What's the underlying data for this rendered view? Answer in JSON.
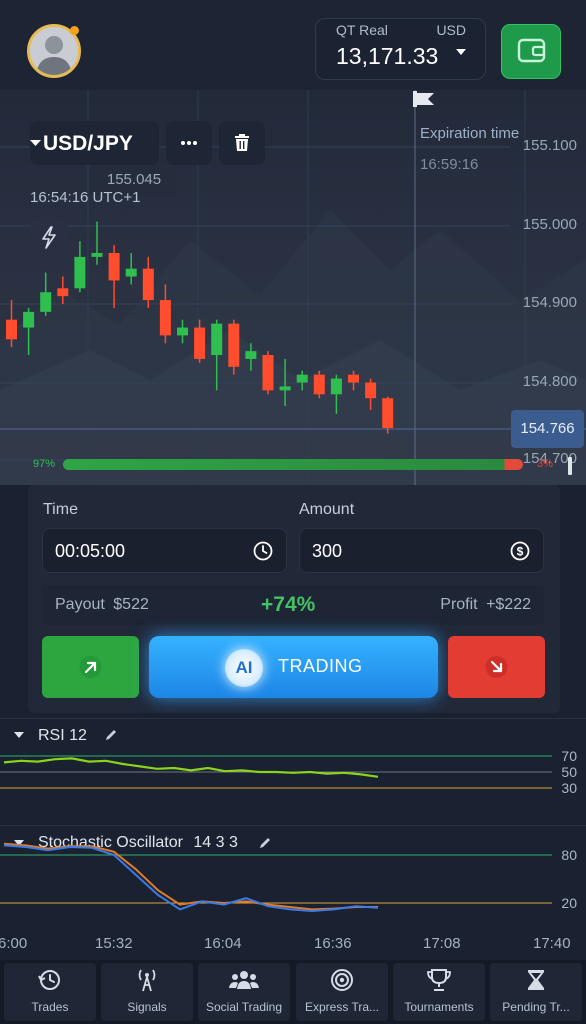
{
  "account": {
    "type_label": "QT Real",
    "currency": "USD",
    "balance": "13,171.33"
  },
  "asset": {
    "pair": "USD/JPY",
    "badge_count": "2"
  },
  "crosshair": {
    "price": "155.045",
    "time": "16:54:16 UTC+1"
  },
  "expiration": {
    "label": "Expiration time",
    "time": "16:59:16"
  },
  "price_axis": [
    "155.100",
    "155.000",
    "154.900",
    "154.800",
    "154.700"
  ],
  "current_price": "154.766",
  "sentiment": {
    "up_pct": "97%",
    "down_pct": "3%",
    "up_fraction": 0.97
  },
  "trade": {
    "time_label": "Time",
    "time_value": "00:05:00",
    "amount_label": "Amount",
    "amount_value": "300",
    "payout_label": "Payout",
    "payout_value": "$522",
    "percent": "+74%",
    "profit_label": "Profit",
    "profit_value": "+$222",
    "ai_badge": "AI",
    "ai_label": "TRADING"
  },
  "rsi": {
    "name": "RSI 12",
    "levels": [
      "70",
      "50",
      "30"
    ]
  },
  "stochastic": {
    "name": "Stochastic Oscillator",
    "params": "14 3 3",
    "levels": [
      "80",
      "20"
    ]
  },
  "time_axis": [
    "6:00",
    "15:32",
    "16:04",
    "16:36",
    "17:08",
    "17:40"
  ],
  "nav": [
    {
      "label": "Trades",
      "icon": "history-icon"
    },
    {
      "label": "Signals",
      "icon": "signal-tower-icon"
    },
    {
      "label": "Social Trading",
      "icon": "users-icon"
    },
    {
      "label": "Express Tra...",
      "icon": "target-icon"
    },
    {
      "label": "Tournaments",
      "icon": "trophy-icon"
    },
    {
      "label": "Pending Tr...",
      "icon": "hourglass-icon"
    }
  ],
  "chart_data": {
    "type": "candlestick",
    "ylim": [
      154.7,
      155.12
    ],
    "candles": [
      {
        "o": 154.88,
        "h": 154.905,
        "c": 154.855,
        "l": 154.845
      },
      {
        "o": 154.87,
        "h": 154.895,
        "c": 154.89,
        "l": 154.835
      },
      {
        "o": 154.89,
        "h": 154.94,
        "c": 154.915,
        "l": 154.885
      },
      {
        "o": 154.92,
        "h": 154.935,
        "c": 154.91,
        "l": 154.9
      },
      {
        "o": 154.92,
        "h": 154.98,
        "c": 154.96,
        "l": 154.915
      },
      {
        "o": 154.96,
        "h": 155.005,
        "c": 154.965,
        "l": 154.95
      },
      {
        "o": 154.965,
        "h": 154.975,
        "c": 154.93,
        "l": 154.895
      },
      {
        "o": 154.935,
        "h": 154.965,
        "c": 154.945,
        "l": 154.925
      },
      {
        "o": 154.945,
        "h": 154.96,
        "c": 154.905,
        "l": 154.895
      },
      {
        "o": 154.905,
        "h": 154.925,
        "c": 154.86,
        "l": 154.85
      },
      {
        "o": 154.86,
        "h": 154.88,
        "c": 154.87,
        "l": 154.85
      },
      {
        "o": 154.87,
        "h": 154.88,
        "c": 154.83,
        "l": 154.825
      },
      {
        "o": 154.835,
        "h": 154.88,
        "c": 154.875,
        "l": 154.79
      },
      {
        "o": 154.875,
        "h": 154.88,
        "c": 154.82,
        "l": 154.81
      },
      {
        "o": 154.83,
        "h": 154.85,
        "c": 154.84,
        "l": 154.815
      },
      {
        "o": 154.835,
        "h": 154.84,
        "c": 154.79,
        "l": 154.785
      },
      {
        "o": 154.79,
        "h": 154.83,
        "c": 154.795,
        "l": 154.77
      },
      {
        "o": 154.8,
        "h": 154.815,
        "c": 154.81,
        "l": 154.79
      },
      {
        "o": 154.81,
        "h": 154.815,
        "c": 154.785,
        "l": 154.78
      },
      {
        "o": 154.785,
        "h": 154.81,
        "c": 154.805,
        "l": 154.76
      },
      {
        "o": 154.81,
        "h": 154.815,
        "c": 154.8,
        "l": 154.79
      },
      {
        "o": 154.8,
        "h": 154.805,
        "c": 154.78,
        "l": 154.765
      },
      {
        "o": 154.78,
        "h": 154.782,
        "c": 154.742,
        "l": 154.735
      }
    ],
    "rsi": [
      62,
      64,
      63,
      66,
      67,
      63,
      64,
      60,
      57,
      54,
      55,
      52,
      55,
      51,
      52,
      50,
      50,
      49,
      50,
      48,
      49,
      47,
      44
    ],
    "stoch_k": [
      92,
      90,
      86,
      90,
      89,
      80,
      55,
      30,
      12,
      22,
      18,
      26,
      16,
      12,
      10,
      12,
      16,
      14
    ],
    "stoch_d": [
      94,
      92,
      88,
      91,
      91,
      84,
      62,
      36,
      18,
      22,
      20,
      22,
      18,
      15,
      12,
      13,
      15,
      15
    ],
    "colors": {
      "up": "#2fbf4f",
      "down": "#ff4d2e",
      "rsi": "#8bd41c",
      "stoch_k": "#3a7be8",
      "stoch_d": "#e07a2a"
    }
  }
}
